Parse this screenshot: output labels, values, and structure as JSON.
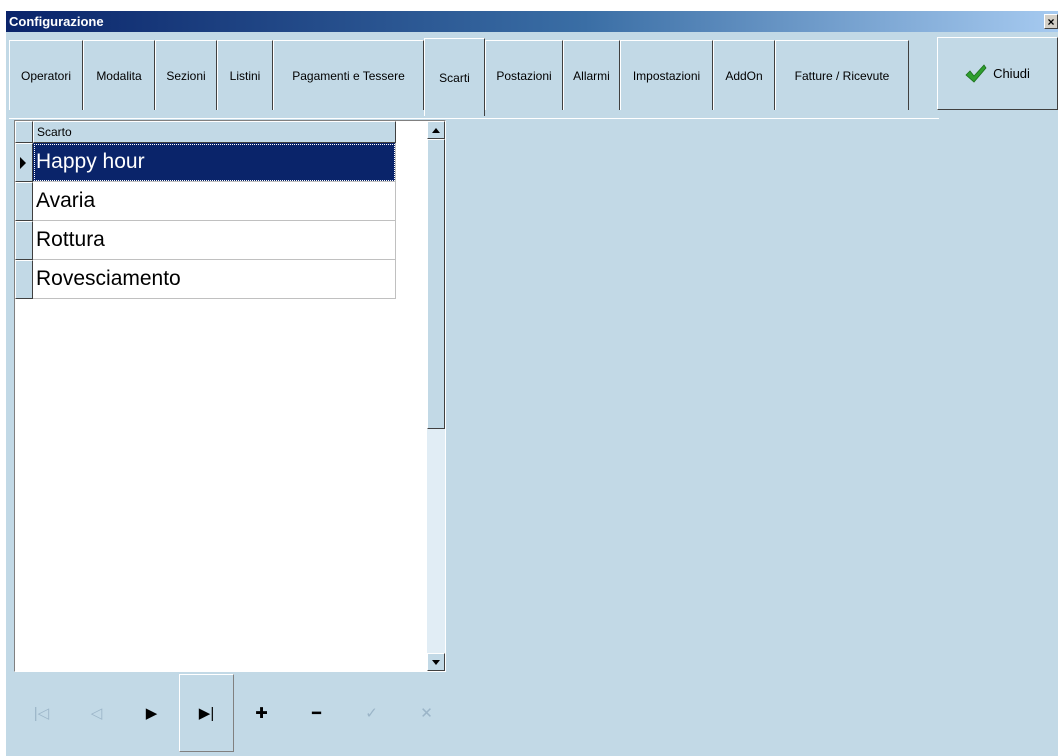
{
  "window": {
    "title": "Configurazione",
    "close_glyph": "×"
  },
  "tabs": [
    {
      "label": "Operatori"
    },
    {
      "label": "Modalita"
    },
    {
      "label": "Sezioni"
    },
    {
      "label": "Listini"
    },
    {
      "label": "Pagamenti e Tessere"
    },
    {
      "label": "Scarti"
    },
    {
      "label": "Postazioni"
    },
    {
      "label": "Allarmi"
    },
    {
      "label": "Impostazioni"
    },
    {
      "label": "AddOn"
    },
    {
      "label": "Fatture / Ricevute"
    }
  ],
  "active_tab": "Scarti",
  "close_button": {
    "label": "Chiudi",
    "icon": "check-icon",
    "icon_color": "#2e9e2e"
  },
  "grid": {
    "column_header": "Scarto",
    "rows": [
      {
        "value": "Happy hour",
        "selected": true
      },
      {
        "value": "Avaria",
        "selected": false
      },
      {
        "value": "Rottura",
        "selected": false
      },
      {
        "value": "Rovesciamento",
        "selected": false
      }
    ]
  },
  "navigator": {
    "buttons": [
      {
        "name": "first",
        "glyph": "|◁",
        "enabled": false
      },
      {
        "name": "prior",
        "glyph": "◁",
        "enabled": false
      },
      {
        "name": "next",
        "glyph": "▶",
        "enabled": true
      },
      {
        "name": "last",
        "glyph": "▶|",
        "enabled": true
      },
      {
        "name": "insert",
        "glyph": "✚",
        "enabled": true
      },
      {
        "name": "delete",
        "glyph": "━",
        "enabled": true
      },
      {
        "name": "post",
        "glyph": "✓",
        "enabled": false
      },
      {
        "name": "cancel",
        "glyph": "✕",
        "enabled": false
      }
    ]
  },
  "colors": {
    "client_bg": "#c2d9e6",
    "selection": "#0a246a",
    "title_start": "#0a246a"
  }
}
